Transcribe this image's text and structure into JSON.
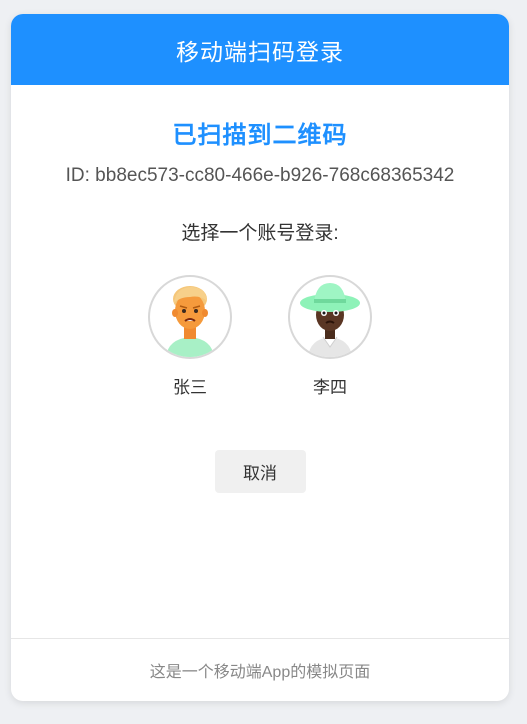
{
  "header": {
    "title": "移动端扫码登录"
  },
  "status": {
    "title": "已扫描到二维码",
    "id_text": "ID: bb8ec573-cc80-466e-b926-768c68365342"
  },
  "prompt": "选择一个账号登录:",
  "accounts": [
    {
      "name": "张三",
      "avatar_icon": "person-blond-avatar-icon"
    },
    {
      "name": "李四",
      "avatar_icon": "person-hat-avatar-icon"
    }
  ],
  "cancel_label": "取消",
  "footer": "这是一个移动端App的模拟页面",
  "colors": {
    "accent": "#1e90ff",
    "background": "#eef0f3"
  }
}
